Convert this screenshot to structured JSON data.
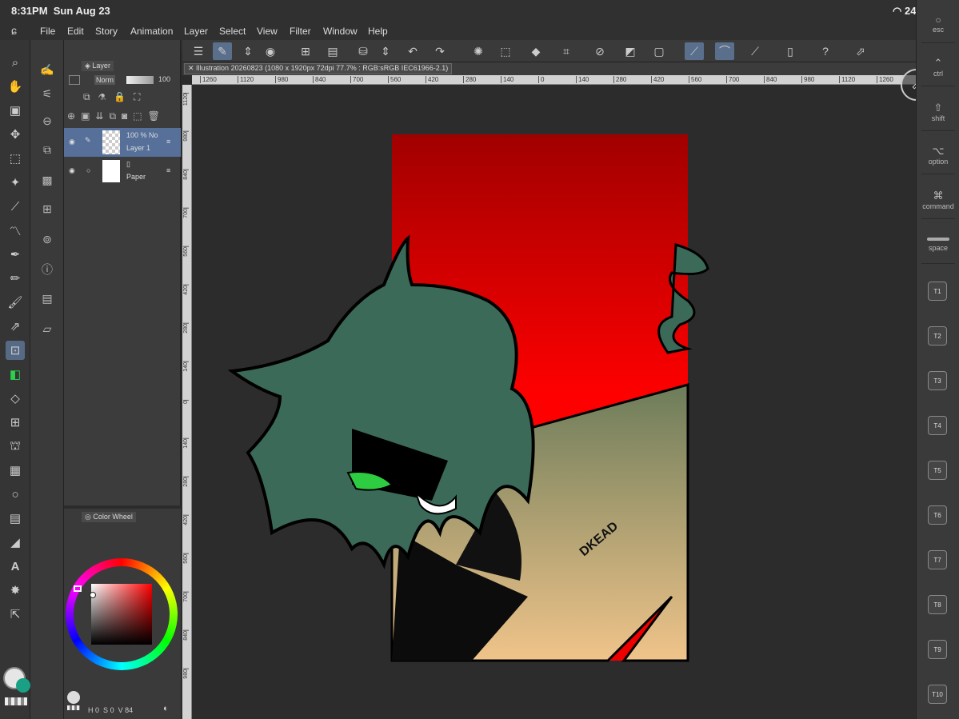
{
  "status": {
    "time": "8:31PM",
    "date": "Sun Aug 23",
    "battery": "24%"
  },
  "menu": [
    "File",
    "Edit",
    "Story",
    "Animation",
    "Layer",
    "Select",
    "View",
    "Filter",
    "Window",
    "Help"
  ],
  "layer_panel": {
    "title": "Layer",
    "blend_mode": "Norm",
    "opacity": "100",
    "layers": [
      {
        "opacity_mode": "100 % No",
        "name": "Layer 1"
      },
      {
        "name": "Paper"
      }
    ]
  },
  "color_panel": {
    "title": "Color Wheel",
    "values": {
      "h": "0",
      "s": "0",
      "v": "84"
    }
  },
  "document": {
    "tab": "Illustration 20260823 (1080 x 1920px 72dpi 77.7% : RGB:sRGB IEC61966-2.1)",
    "ruler_top": [
      "1260",
      "1120",
      "980",
      "840",
      "700",
      "560",
      "420",
      "280",
      "140",
      "0",
      "140",
      "280",
      "420",
      "560",
      "700",
      "840",
      "980",
      "1120",
      "1260"
    ],
    "ruler_left": [
      "1120",
      "980",
      "840",
      "700",
      "560",
      "420",
      "280",
      "140",
      "0",
      "140",
      "280",
      "420",
      "560",
      "700",
      "840",
      "980"
    ]
  },
  "artwork": {
    "jacket_text": "DKEAD",
    "colors": {
      "background": "#e00000",
      "hair": "#3b6a58",
      "eye": "#2ecc40",
      "jacket": "#c78a4a"
    }
  },
  "right_keys": {
    "modifiers": [
      "esc",
      "ctrl",
      "shift",
      "option",
      "command",
      "space"
    ],
    "modifier_glyphs": [
      "⌃",
      "⇧",
      "⌥",
      "⌘"
    ],
    "tkeys": [
      "T1",
      "T2",
      "T3",
      "T4",
      "T5",
      "T6",
      "T7",
      "T8",
      "T9",
      "T10"
    ]
  }
}
